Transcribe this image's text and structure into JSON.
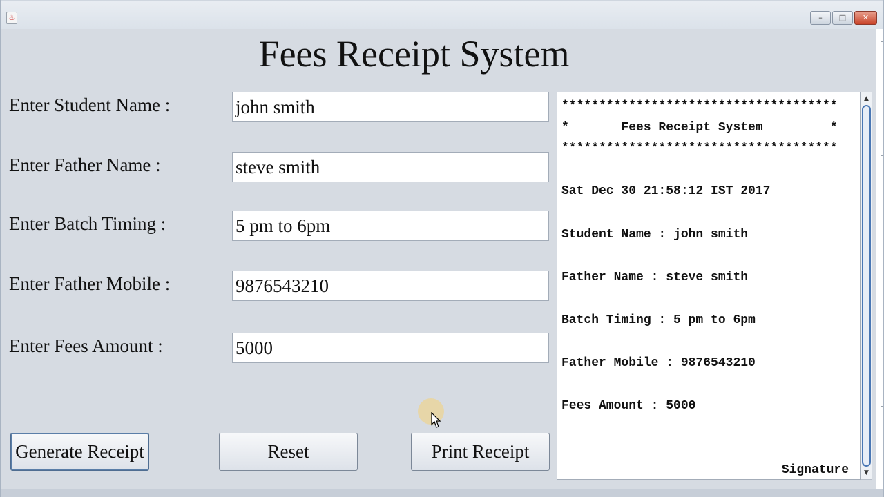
{
  "window": {
    "app_icon": "java-coffee-icon",
    "controls": {
      "minimize": "–",
      "maximize": "□",
      "close": "✕"
    }
  },
  "title": "Fees Receipt System",
  "form": {
    "student_name": {
      "label": "Enter Student Name :",
      "value": "john smith"
    },
    "father_name": {
      "label": "Enter Father Name :",
      "value": "steve smith"
    },
    "batch_timing": {
      "label": "Enter Batch Timing :",
      "value": "5 pm to 6pm"
    },
    "father_mobile": {
      "label": "Enter Father Mobile :",
      "value": "9876543210"
    },
    "fees_amount": {
      "label": "Enter Fees Amount :",
      "value": "5000"
    }
  },
  "buttons": {
    "generate": "Generate Receipt",
    "reset": "Reset",
    "print": "Print Receipt"
  },
  "receipt": {
    "border_top": "*************************************",
    "header": "*       Fees Receipt System         *",
    "border_bottom": "*************************************",
    "date": "Sat Dec 30 21:58:12 IST 2017",
    "student": "Student Name : john smith",
    "father": "Father Name : steve smith",
    "batch": "Batch Timing : 5 pm to 6pm",
    "mobile": "Father Mobile : 9876543210",
    "fees": "Fees Amount : 5000",
    "signature": "Signature"
  },
  "colors": {
    "window_bg": "#d6dbe2",
    "scroll_thumb": "#4a77b4",
    "close_button": "#c9442a"
  }
}
